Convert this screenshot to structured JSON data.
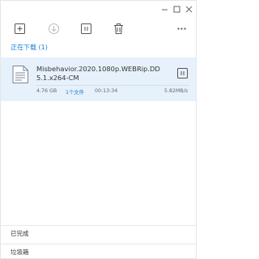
{
  "window": {
    "controls": {
      "minimize": "—",
      "maximize": "□",
      "close": "✕"
    }
  },
  "toolbar": {
    "buttons": [
      {
        "icon": "add-icon"
      },
      {
        "icon": "download-icon"
      },
      {
        "icon": "pause-icon"
      },
      {
        "icon": "trash-icon"
      },
      {
        "icon": "more-icon"
      }
    ]
  },
  "sections": {
    "downloading_label": "正在下载 (1)",
    "completed_label": "已完成",
    "trash_label": "垃圾箱"
  },
  "download": {
    "file_name": "Misbehavior.2020.1080p.WEBRip.DD5.1.x264-CM",
    "size": "4.76 GB",
    "file_count": "1个文件",
    "time_remaining": "00:13:34",
    "speed": "5.82MB/s",
    "progress": 0
  },
  "colors": {
    "accent": "#1a7fd4",
    "item_highlight": "#e7f1fb"
  }
}
